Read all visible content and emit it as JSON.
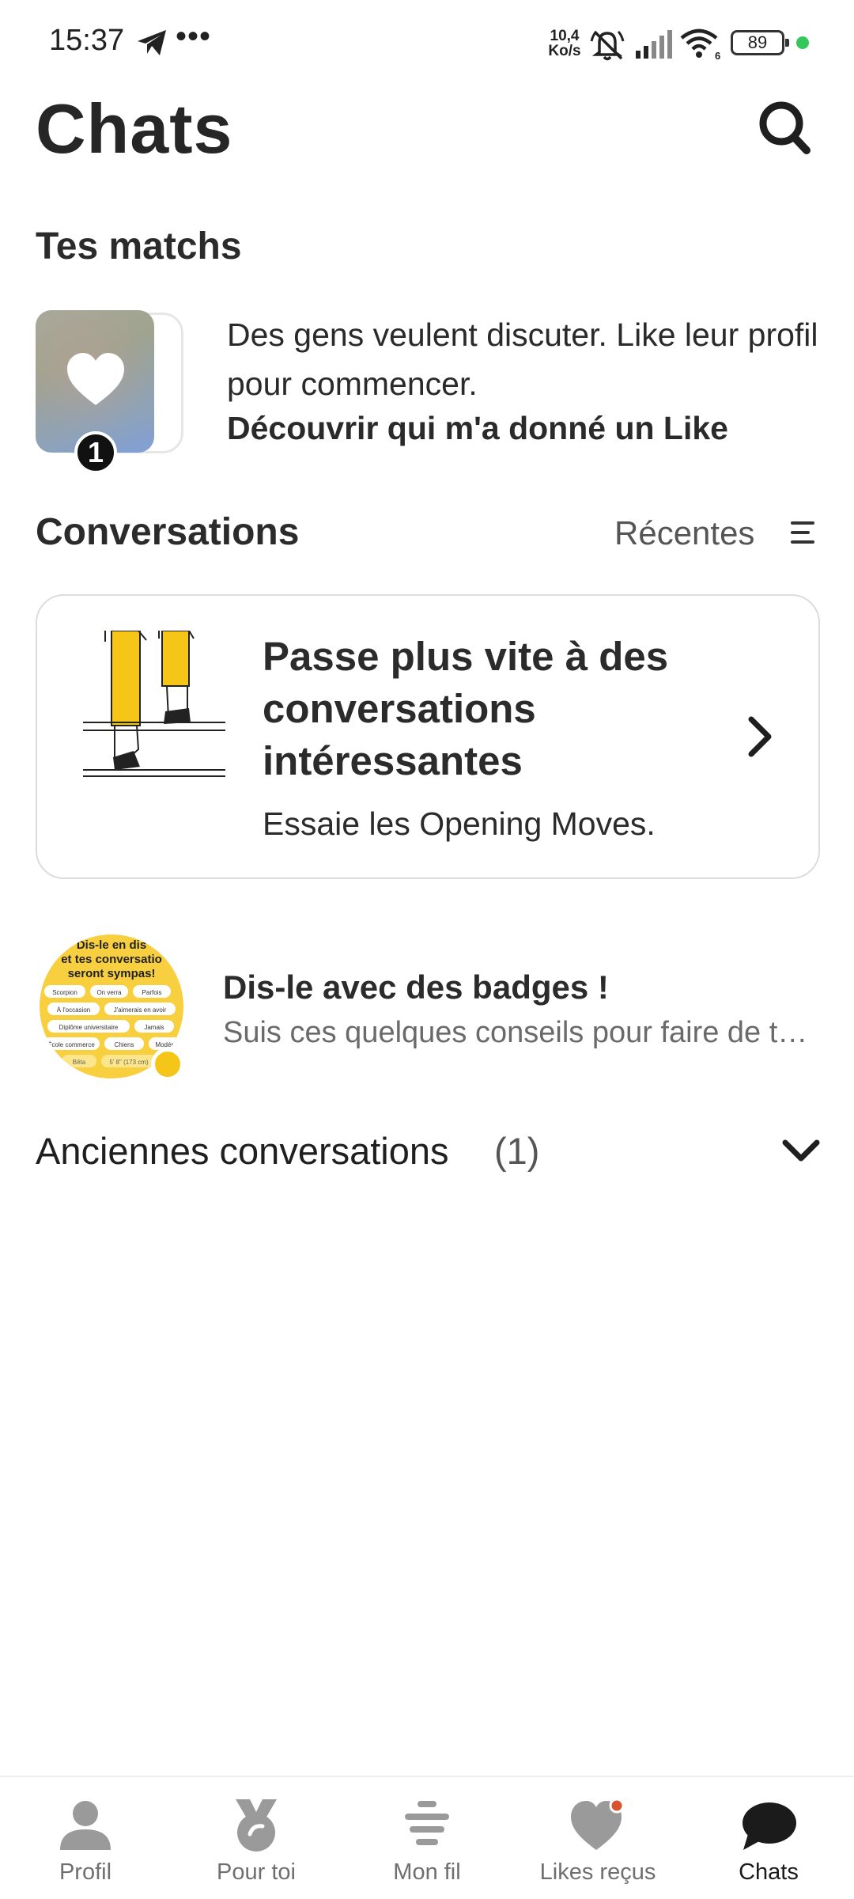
{
  "status_bar": {
    "time": "15:37",
    "more": "•••",
    "network_speed_value": "10,4",
    "network_speed_unit": "Ko/s",
    "wifi_label": "6",
    "battery": "89"
  },
  "header": {
    "title": "Chats"
  },
  "matches": {
    "title": "Tes matchs",
    "count": "1",
    "text": "Des gens veulent discuter. Like leur profil pour commencer.",
    "link": "Découvrir qui m'a donné un Like"
  },
  "conversations": {
    "title": "Conversations",
    "sort_label": "Récentes"
  },
  "promo": {
    "title": "Passe plus vite à des conversations intéressantes",
    "subtitle": "Essaie les Opening Moves."
  },
  "badges_item": {
    "title": "Dis-le avec des badges !",
    "subtitle": "Suis ces quelques conseils pour faire de t…",
    "thumb_text_line1": "Dis-le en dis",
    "thumb_text_line2": "et tes conversatio",
    "thumb_text_line3": "seront sympas!",
    "chips": [
      "Scorpion",
      "On verra",
      "Parfois",
      "À l'occasion",
      "J'aimerais en avoir",
      "Diplôme universitaire",
      "Jamais",
      "École commerce",
      "Chiens",
      "Modéré",
      "Bêta",
      "5' 8\" (173 cm)"
    ]
  },
  "old_conversations": {
    "label": "Anciennes conversations",
    "count": "(1)"
  },
  "bottom_nav": {
    "items": [
      {
        "label": "Profil"
      },
      {
        "label": "Pour toi"
      },
      {
        "label": "Mon fil"
      },
      {
        "label": "Likes reçus"
      },
      {
        "label": "Chats"
      }
    ]
  },
  "colors": {
    "accent_yellow": "#f5c518",
    "online_green": "#34c759",
    "notification_dot": "#d9532b"
  }
}
